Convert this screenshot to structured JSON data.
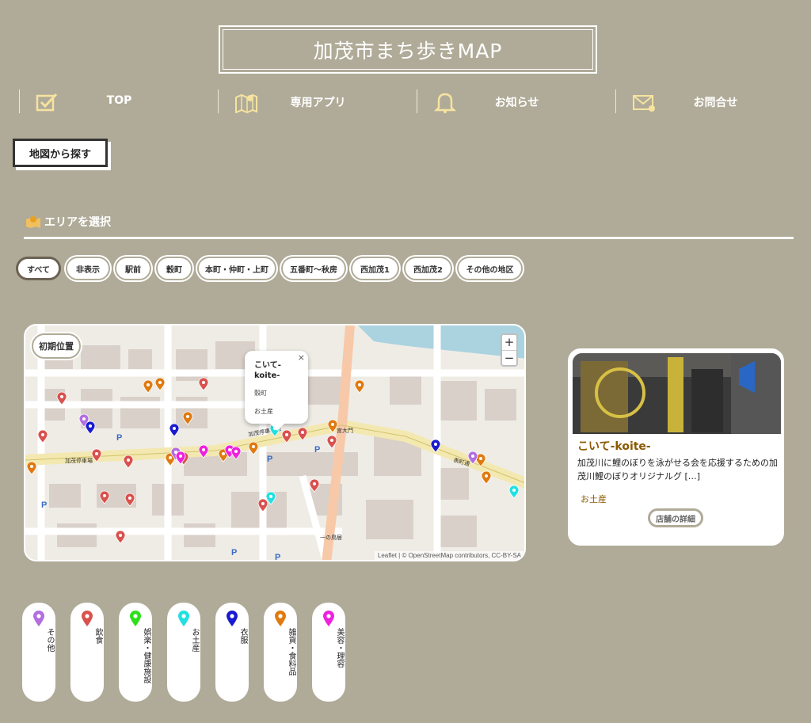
{
  "header": {
    "title": "加茂市まち歩きMAP"
  },
  "nav": [
    {
      "label": "TOP",
      "icon": "checkbox-icon"
    },
    {
      "label": "専用アプリ",
      "icon": "map-icon"
    },
    {
      "label": "お知らせ",
      "icon": "bell-icon"
    },
    {
      "label": "お問合せ",
      "icon": "mail-icon"
    }
  ],
  "search_button": "地図から探す",
  "area_heading": "エリアを選択",
  "area_chips": [
    "すべて",
    "非表示",
    "駅前",
    "穀町",
    "本町・仲町・上町",
    "五番町〜秋房",
    "西加茂1",
    "西加茂2",
    "その他の地区"
  ],
  "map": {
    "init_button": "初期位置",
    "zoom_in": "+",
    "zoom_out": "−",
    "attribution": "Leaflet | © OpenStreetMap contributors, CC-BY-SA",
    "popup": {
      "name": "こいて-koite-",
      "area": "穀町",
      "category": "お土産",
      "close": "×"
    },
    "street_labels": [
      "加茂停車場線",
      "加茂停車場",
      "表町通",
      "宮大門",
      "一の鳥居"
    ]
  },
  "card": {
    "title": "こいて-koite-",
    "description": "加茂川に鯉のぼりを泳がせる会を応援するための加茂川鯉のぼりオリジナルグ […]",
    "category": "お土産",
    "button": "店舗の詳細"
  },
  "legend": [
    {
      "label": "その他",
      "color": "#b26ee0"
    },
    {
      "label": "飲食",
      "color": "#d9514e"
    },
    {
      "label": "娯楽・健康施設",
      "color": "#2ee01a"
    },
    {
      "label": "お土産",
      "color": "#22e0e0"
    },
    {
      "label": "衣服",
      "color": "#1a1ad0"
    },
    {
      "label": "雑貨・食料品",
      "color": "#e07a10"
    },
    {
      "label": "美容・理容",
      "color": "#ee22dd"
    }
  ],
  "colors": {
    "background": "#b0ab98",
    "accent": "#8a5a00"
  }
}
